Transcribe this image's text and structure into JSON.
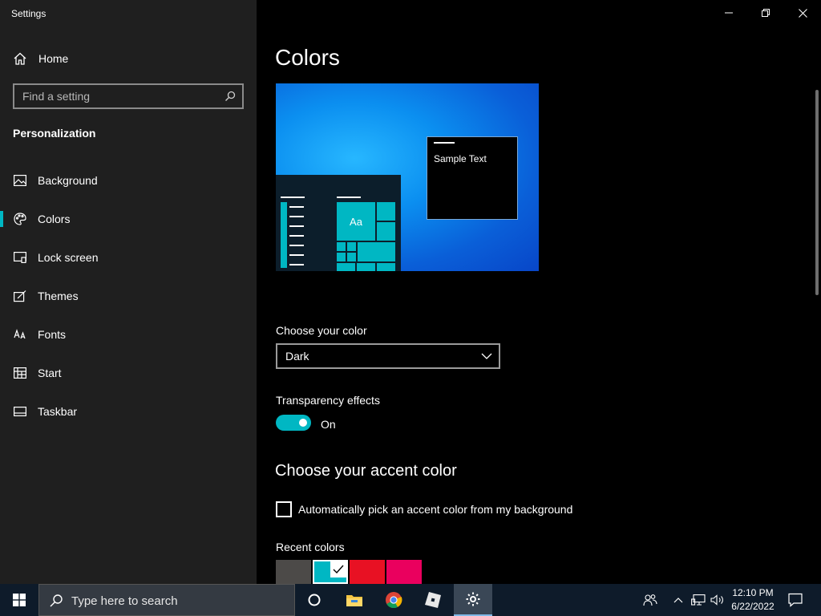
{
  "window": {
    "title": "Settings",
    "controls": {
      "minimize": "minimize-icon",
      "restore": "restore-icon",
      "close": "close-icon"
    }
  },
  "sidebar": {
    "home_label": "Home",
    "search_placeholder": "Find a setting",
    "section_title": "Personalization",
    "items": [
      {
        "label": "Background",
        "icon": "picture-icon"
      },
      {
        "label": "Colors",
        "icon": "palette-icon",
        "active": true
      },
      {
        "label": "Lock screen",
        "icon": "lock-screen-icon"
      },
      {
        "label": "Themes",
        "icon": "brush-icon"
      },
      {
        "label": "Fonts",
        "icon": "font-icon"
      },
      {
        "label": "Start",
        "icon": "start-icon"
      },
      {
        "label": "Taskbar",
        "icon": "taskbar-icon"
      }
    ]
  },
  "main": {
    "title": "Colors",
    "preview": {
      "sample_text": "Sample Text",
      "tile_text": "Aa"
    },
    "choose_color": {
      "label": "Choose your color",
      "value": "Dark"
    },
    "transparency": {
      "label": "Transparency effects",
      "state": "On",
      "enabled": true
    },
    "accent": {
      "heading": "Choose your accent color",
      "auto_pick_label": "Automatically pick an accent color from my background",
      "auto_pick_checked": false,
      "recent_label": "Recent colors",
      "recent_colors": [
        "#4c4a48",
        "#00b7c3",
        "#e81123",
        "#ea005e"
      ],
      "selected_index": 1
    }
  },
  "taskbar": {
    "search_placeholder": "Type here to search",
    "apps": [
      "cortana-icon",
      "file-explorer-icon",
      "chrome-icon",
      "roblox-icon",
      "settings-icon"
    ],
    "tray_icons": [
      "people-icon",
      "chevron-up-icon",
      "network-icon",
      "volume-icon",
      "notification-icon"
    ],
    "time": "12:10 PM",
    "date": "6/22/2022"
  },
  "colors": {
    "accent": "#00b7c3",
    "sidebar_bg": "#1f1f1f",
    "main_bg": "#000000",
    "taskbar_bg": "#0e1b2a"
  }
}
